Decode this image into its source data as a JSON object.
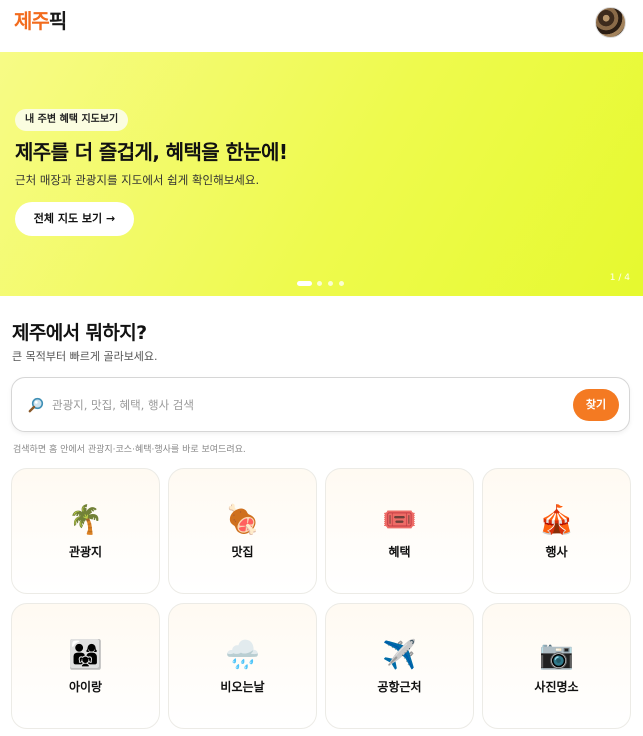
{
  "header": {
    "logo_part1": "제주",
    "logo_part2": "픽"
  },
  "banner": {
    "chip": "내 주변 혜택 지도보기",
    "title": "제주를 더 즐겁게, 혜택을 한눈에!",
    "subtitle": "근처 매장과 관광지를 지도에서 쉽게 확인해보세요.",
    "button": "전체 지도 보기 →",
    "pager": "1 / 4",
    "slide_count": 4,
    "active_slide": 1
  },
  "section": {
    "title": "제주에서 뭐하지?",
    "subtitle": "큰 목적부터 빠르게 골라보세요."
  },
  "search": {
    "placeholder": "관광지, 맛집, 혜택, 행사 검색",
    "button": "찾기",
    "help": "검색하면 홈 안에서 관광지·코스·혜택·행사를 바로 보여드려요."
  },
  "categories": [
    {
      "label": "관광지",
      "icon": "🌴",
      "icon_name": "palm-tree-icon"
    },
    {
      "label": "맛집",
      "icon": "🍖",
      "icon_name": "meat-icon"
    },
    {
      "label": "혜택",
      "icon": "🎟️",
      "icon_name": "ticket-icon"
    },
    {
      "label": "행사",
      "icon": "🎪",
      "icon_name": "circus-tent-icon"
    },
    {
      "label": "아이랑",
      "icon": "👨‍👩‍👧",
      "icon_name": "family-icon"
    },
    {
      "label": "비오는날",
      "icon": "🌧️",
      "icon_name": "rain-cloud-icon"
    },
    {
      "label": "공항근처",
      "icon": "✈️",
      "icon_name": "airplane-icon"
    },
    {
      "label": "사진명소",
      "icon": "📷",
      "icon_name": "camera-icon"
    }
  ],
  "colors": {
    "brand": "#f26b1d",
    "search_button": "#f47a22",
    "banner": "#eefa4d"
  }
}
